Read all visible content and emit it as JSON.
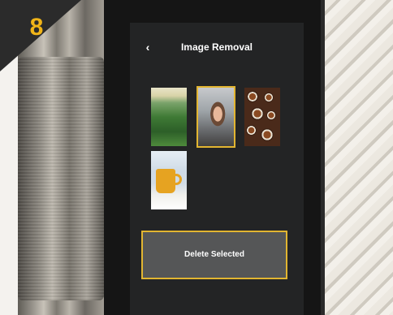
{
  "step_badge": {
    "number": "8",
    "color": "#f0b418"
  },
  "screen": {
    "title": "Image Removal",
    "back_icon": "chevron-left-icon",
    "back_glyph": "‹"
  },
  "gallery": {
    "images": [
      {
        "subject": "green-mountain-forest",
        "selected": false
      },
      {
        "subject": "woman-portrait",
        "selected": true
      },
      {
        "subject": "coffee-cups-overhead",
        "selected": false
      },
      {
        "subject": "yellow-mug-on-table",
        "selected": false
      }
    ]
  },
  "actions": {
    "delete_label": "Delete Selected"
  },
  "colors": {
    "accent": "#e2b531",
    "screen_bg": "#232425",
    "button_bg": "#555657"
  }
}
